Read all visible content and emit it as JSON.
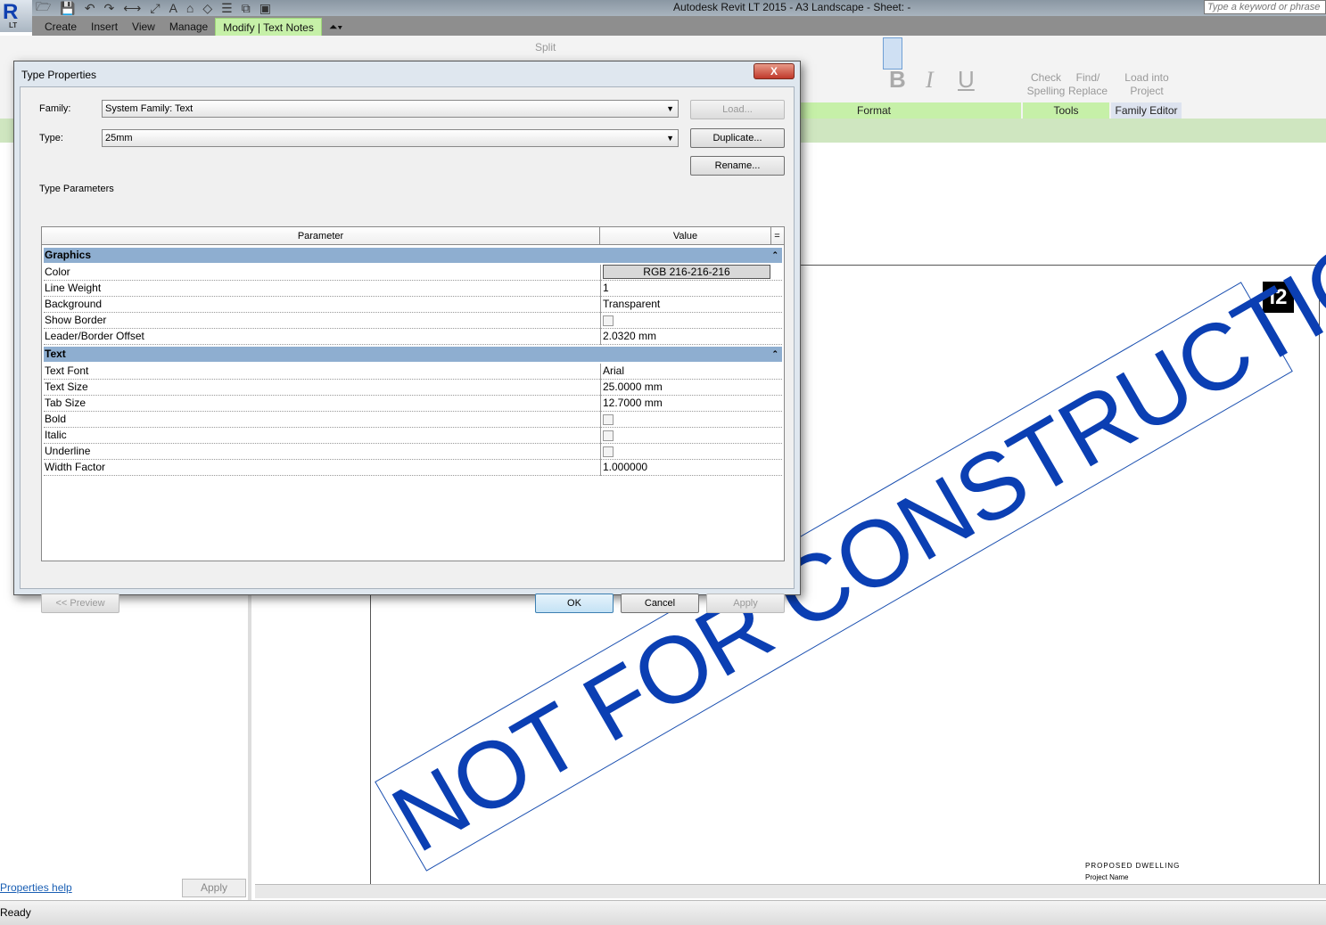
{
  "app": {
    "title": "Autodesk Revit LT 2015 -    A3 Landscape - Sheet:  -",
    "logo": "R",
    "logo_sub": "LT",
    "search_placeholder": "Type a keyword or phrase"
  },
  "tabs": [
    {
      "label": "Create"
    },
    {
      "label": "Insert"
    },
    {
      "label": "View"
    },
    {
      "label": "Manage"
    },
    {
      "label": "Modify | Text Notes"
    }
  ],
  "ribbon": {
    "split_label": "Split",
    "check_spelling": "Check Spelling",
    "find_replace": "Find/ Replace",
    "load_into_project": "Load into Project",
    "panels": {
      "format": "Format",
      "tools": "Tools",
      "family_editor": "Family Editor"
    },
    "bold": "B",
    "italic": "I",
    "underline": "U"
  },
  "dialog": {
    "title": "Type Properties",
    "close": "X",
    "family_label": "Family:",
    "family_value": "System Family: Text",
    "type_label": "Type:",
    "type_value": "25mm",
    "load": "Load...",
    "duplicate": "Duplicate...",
    "rename": "Rename...",
    "type_parameters": "Type Parameters",
    "col_parameter": "Parameter",
    "col_value": "Value",
    "groups": [
      {
        "name": "Graphics",
        "rows": [
          {
            "param": "Color",
            "value": "RGB 216-216-216"
          },
          {
            "param": "Line Weight",
            "value": "1"
          },
          {
            "param": "Background",
            "value": "Transparent"
          },
          {
            "param": "Show Border",
            "value": ""
          },
          {
            "param": "Leader/Border Offset",
            "value": "2.0320 mm"
          }
        ]
      },
      {
        "name": "Text",
        "rows": [
          {
            "param": "Text Font",
            "value": "Arial"
          },
          {
            "param": "Text Size",
            "value": "25.0000 mm"
          },
          {
            "param": "Tab Size",
            "value": "12.7000 mm"
          },
          {
            "param": "Bold",
            "value": ""
          },
          {
            "param": "Italic",
            "value": ""
          },
          {
            "param": "Underline",
            "value": ""
          },
          {
            "param": "Width Factor",
            "value": "1.000000"
          }
        ]
      }
    ],
    "preview": "<< Preview",
    "ok": "OK",
    "cancel": "Cancel",
    "apply": "Apply"
  },
  "properties": {
    "help": "Properties help",
    "apply": "Apply"
  },
  "canvas": {
    "watermark": "NOT FOR CONSTRUCTION",
    "project_title": "PROPOSED DWELLING",
    "project_name": "Project Name",
    "logo": "i2"
  },
  "status": {
    "text": "Ready"
  }
}
